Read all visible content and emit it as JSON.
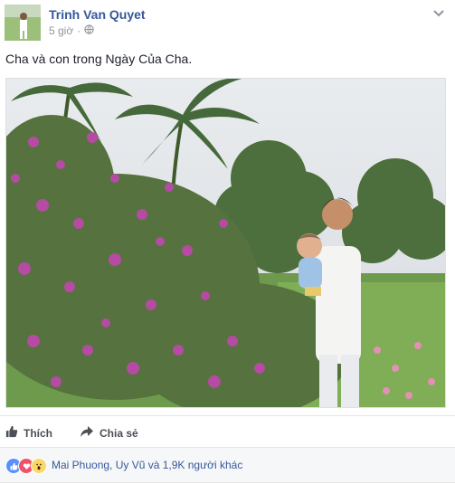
{
  "post": {
    "author": "Trinh Van Quyet",
    "time": "5 giờ",
    "audience_icon": "globe-icon",
    "caption": "Cha và con trong Ngày Của Cha."
  },
  "actions": {
    "like_label": "Thích",
    "share_label": "Chia sẻ"
  },
  "reactions": {
    "icons": [
      "like-icon",
      "love-icon",
      "wow-icon"
    ],
    "summary": "Mai Phuong, Uy Vũ và 1,9K người khác"
  },
  "colors": {
    "author_link": "#365899",
    "meta_gray": "#90949c",
    "like_blue": "#5890ff",
    "love_red": "#f25268",
    "wow_yellow": "#fcd669"
  }
}
